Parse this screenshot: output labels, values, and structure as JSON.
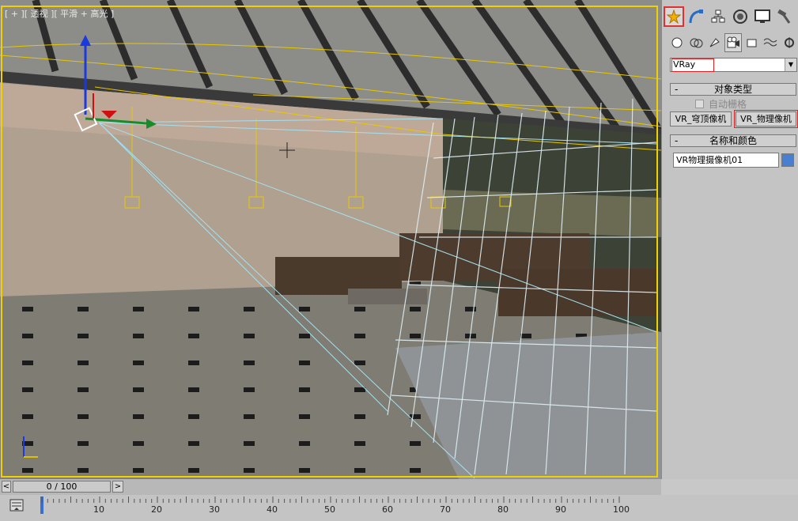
{
  "viewport": {
    "label": "[ + ][ 透视 ][ 平滑 + 高光 ]"
  },
  "command_panel": {
    "tabs": [
      "create-icon",
      "modify-icon",
      "hierarchy-icon",
      "motion-icon",
      "display-icon",
      "utilities-icon"
    ],
    "subtabs": [
      "geometry-icon",
      "shapes-icon",
      "lights-icon",
      "cameras-icon",
      "helpers-icon",
      "spacewarps-icon",
      "systems-icon"
    ],
    "dropdown_value": "VRay",
    "object_type_title": "对象类型",
    "autogrid_label": "自动栅格",
    "button_dome_camera": "VR_穹顶像机",
    "button_physical_camera": "VR_物理像机",
    "name_color_title": "名称和颜色",
    "object_name": "VR物理摄像机01",
    "object_color": "#4a7fd0",
    "rollout_minus": "-"
  },
  "timeline": {
    "frame_display": "0 / 100",
    "prev": "<",
    "next": ">",
    "ticks": [
      "10",
      "20",
      "30",
      "40",
      "50",
      "60",
      "70",
      "80",
      "90",
      "100"
    ]
  }
}
